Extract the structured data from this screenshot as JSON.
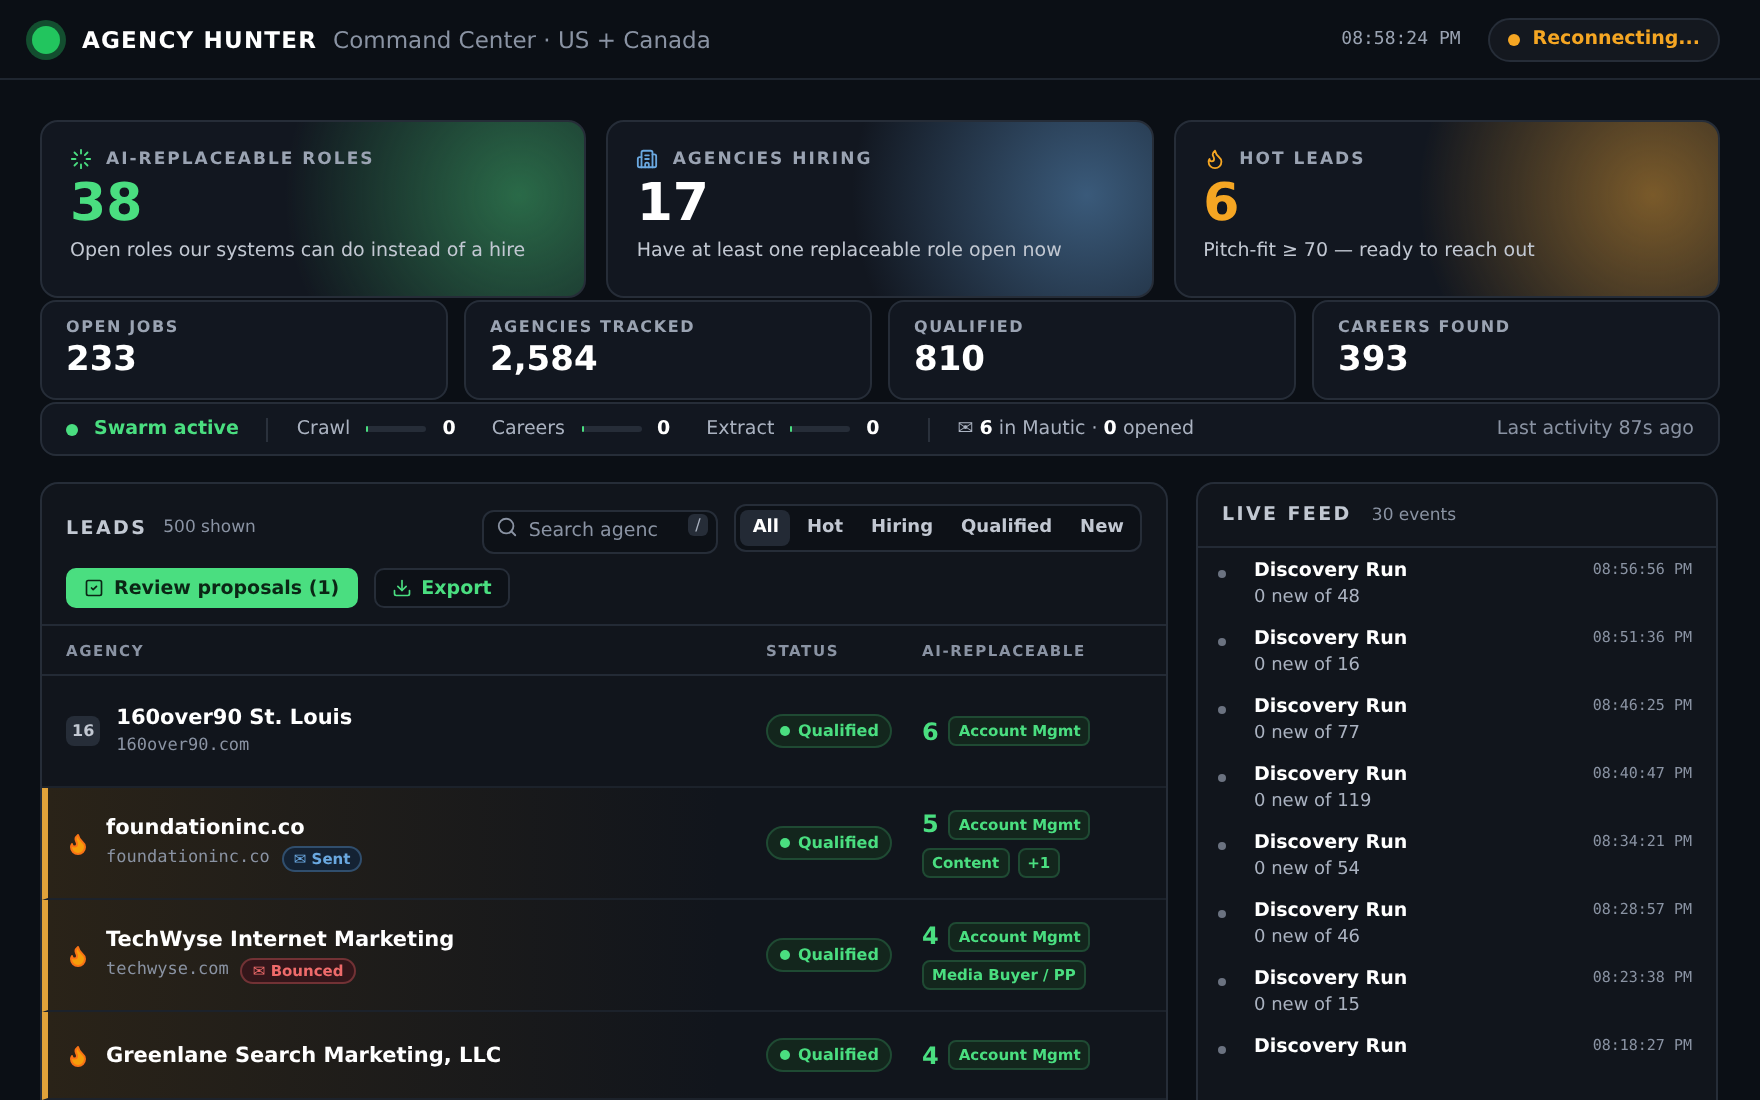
{
  "header": {
    "brand": "AGENCY HUNTER",
    "subtitle": "Command Center · US + Canada",
    "clock": "08:58:24 PM",
    "connection": {
      "label": "Reconnecting..."
    }
  },
  "hero_cards": [
    {
      "kind": "roles",
      "label": "AI-REPLACEABLE ROLES",
      "value": "38",
      "caption": "Open roles our systems can do instead of a hire",
      "color": "#4ade80"
    },
    {
      "kind": "hiring",
      "label": "AGENCIES HIRING",
      "value": "17",
      "caption": "Have at least one replaceable role open now",
      "color": "#ffffff"
    },
    {
      "kind": "hot",
      "label": "HOT LEADS",
      "value": "6",
      "caption": "Pitch-fit ≥ 70 — ready to reach out",
      "color": "#f5a623"
    }
  ],
  "stats": [
    {
      "label": "OPEN JOBS",
      "value": "233"
    },
    {
      "label": "AGENCIES TRACKED",
      "value": "2,584"
    },
    {
      "label": "QUALIFIED",
      "value": "810"
    },
    {
      "label": "CAREERS FOUND",
      "value": "393"
    }
  ],
  "swarm": {
    "status": "Swarm active",
    "active": true,
    "workers": [
      {
        "name": "Crawl",
        "level": 0,
        "count": "0"
      },
      {
        "name": "Careers",
        "level": 0,
        "count": "0"
      },
      {
        "name": "Extract",
        "level": 0,
        "count": "0"
      }
    ],
    "mautic": "✉ **6** in Mautic · **0** opened",
    "last_activity": "Last activity 87s ago"
  },
  "leads": {
    "title": "LEADS",
    "count": "500 shown",
    "search": {
      "placeholder": "Search agenc",
      "shortcut": "/"
    },
    "filters": [
      {
        "label": "All",
        "selected": true
      },
      {
        "label": "Hot",
        "selected": false
      },
      {
        "label": "Hiring",
        "selected": false
      },
      {
        "label": "Qualified",
        "selected": false
      },
      {
        "label": "New",
        "selected": false
      }
    ],
    "actions": [
      {
        "kind": "primary",
        "label": "Review proposals (1)"
      },
      {
        "kind": "secondary",
        "label": "Export"
      }
    ],
    "columns": [
      "AGENCY",
      "STATUS",
      "AI-REPLACEABLE"
    ],
    "rows": [
      {
        "hot": false,
        "rank": "16",
        "name": "160over90 St. Louis",
        "domain": "160over90.com",
        "status": "Qualified",
        "score": "6",
        "tags": [
          "Account Mgmt"
        ]
      },
      {
        "hot": true,
        "name": "foundationinc.co",
        "domain": "foundationinc.co",
        "outreach": {
          "kind": "sent",
          "label": "✉ Sent"
        },
        "status": "Qualified",
        "score": "5",
        "tags": [
          "Account Mgmt",
          "Content",
          "+1"
        ]
      },
      {
        "hot": true,
        "name": "TechWyse Internet Marketing",
        "domain": "techwyse.com",
        "outreach": {
          "kind": "bounced",
          "label": "✉ Bounced"
        },
        "status": "Qualified",
        "score": "4",
        "tags": [
          "Account Mgmt",
          "Media Buyer / PP"
        ]
      },
      {
        "hot": true,
        "name": "Greenlane Search Marketing, LLC",
        "status": "Qualified",
        "score": "4",
        "tags": [
          "Account Mgmt"
        ]
      }
    ]
  },
  "feed": {
    "title": "LIVE FEED",
    "count": "30 events",
    "events": [
      {
        "title": "Discovery Run",
        "detail": "0 new of 48",
        "time": "08:56:56 PM"
      },
      {
        "title": "Discovery Run",
        "detail": "0 new of 16",
        "time": "08:51:36 PM"
      },
      {
        "title": "Discovery Run",
        "detail": "0 new of 77",
        "time": "08:46:25 PM"
      },
      {
        "title": "Discovery Run",
        "detail": "0 new of 119",
        "time": "08:40:47 PM"
      },
      {
        "title": "Discovery Run",
        "detail": "0 new of 54",
        "time": "08:34:21 PM"
      },
      {
        "title": "Discovery Run",
        "detail": "0 new of 46",
        "time": "08:28:57 PM"
      },
      {
        "title": "Discovery Run",
        "detail": "0 new of 15",
        "time": "08:23:38 PM"
      },
      {
        "title": "Discovery Run",
        "time": "08:18:27 PM"
      }
    ]
  }
}
